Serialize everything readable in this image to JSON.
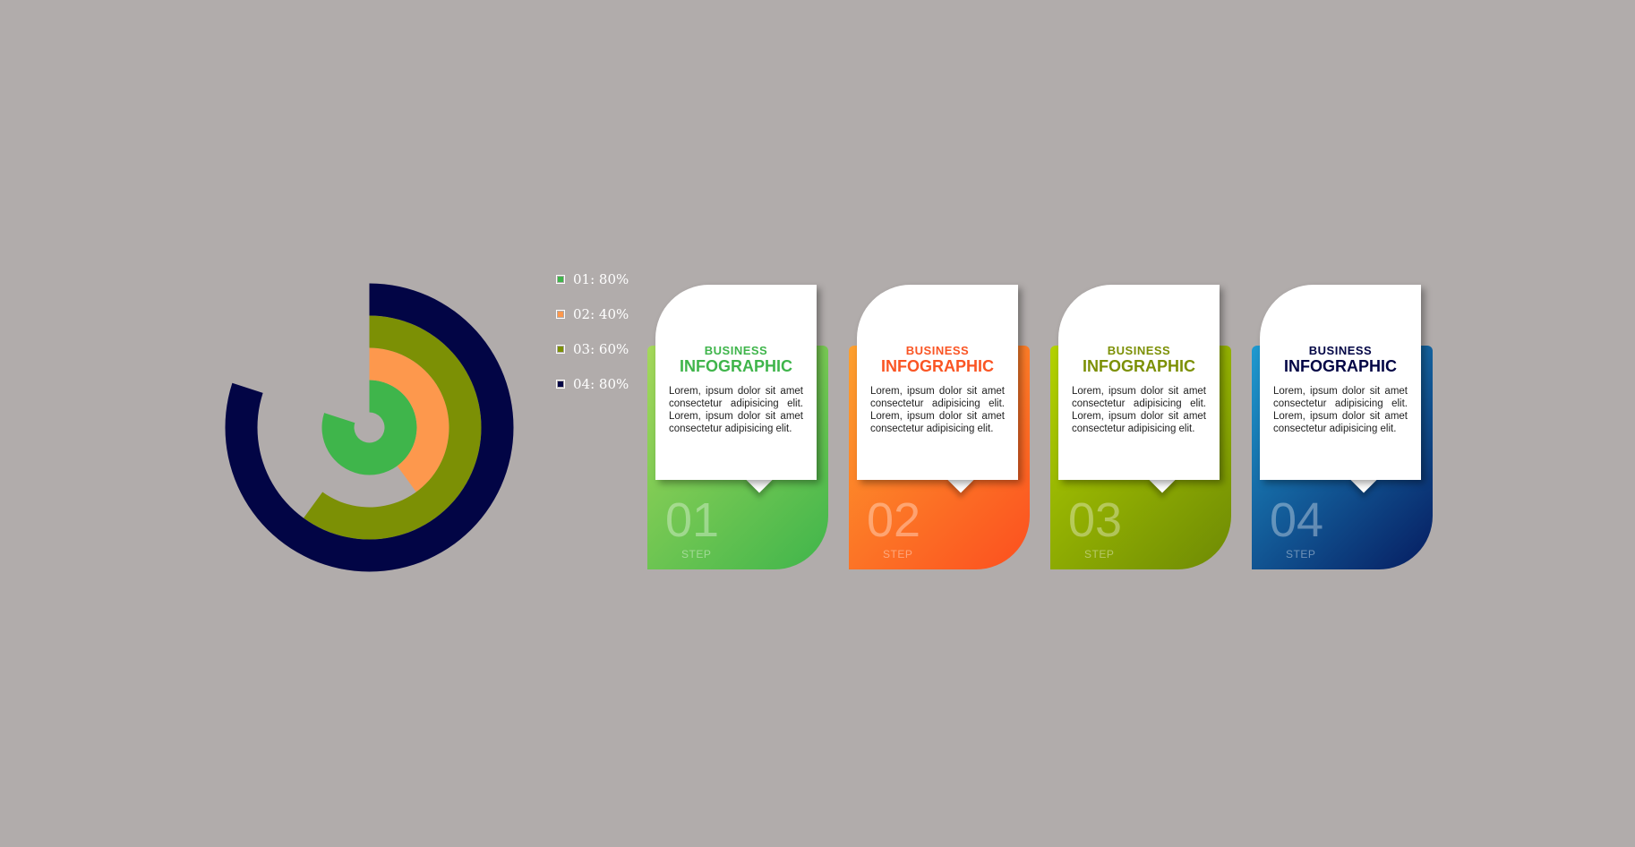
{
  "chart_data": {
    "type": "radial-bar",
    "series": [
      {
        "label": "01: 80%",
        "value": 80,
        "color": "#3fb54b"
      },
      {
        "label": "02: 40%",
        "value": 40,
        "color": "#fd984d"
      },
      {
        "label": "03: 60%",
        "value": 60,
        "color": "#7c9005"
      },
      {
        "label": "04: 80%",
        "value": 80,
        "color": "#020545"
      }
    ]
  },
  "cards": [
    {
      "title1": "BUSINESS",
      "title2": "INFOGRAPHIC",
      "text": "Lorem, ipsum dolor sit amet consectetur adipisicing elit. Lorem, ipsum dolor sit amet consectetur adipisicing elit.",
      "number": "01",
      "step": "STEP",
      "title_color": "#3fb54b",
      "grad_start": "#a5d85a",
      "grad_end": "#3fb54b"
    },
    {
      "title1": "BUSINESS",
      "title2": "INFOGRAPHIC",
      "text": "Lorem, ipsum dolor sit amet consectetur adipisicing elit. Lorem, ipsum dolor sit amet consectetur adipisicing elit.",
      "number": "02",
      "step": "STEP",
      "title_color": "#fa5524",
      "grad_start": "#fda02e",
      "grad_end": "#fc4f1f"
    },
    {
      "title1": "BUSINESS",
      "title2": "INFOGRAPHIC",
      "text": "Lorem, ipsum dolor sit amet consectetur adipisicing elit. Lorem, ipsum dolor sit amet consectetur adipisicing elit.",
      "number": "03",
      "step": "STEP",
      "title_color": "#7c9005",
      "grad_start": "#b3d200",
      "grad_end": "#6e8a04"
    },
    {
      "title1": "BUSINESS",
      "title2": "INFOGRAPHIC",
      "text": "Lorem, ipsum dolor sit amet consectetur adipisicing elit. Lorem, ipsum dolor sit amet consectetur adipisicing elit.",
      "number": "04",
      "step": "STEP",
      "title_color": "#020545",
      "grad_start": "#1f9ad0",
      "grad_end": "#061c60"
    }
  ]
}
